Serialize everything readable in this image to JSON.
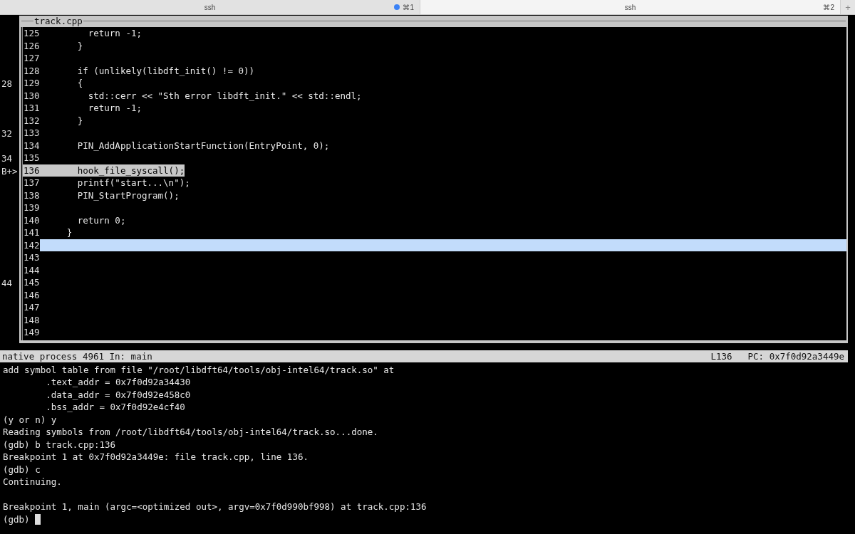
{
  "tabs": [
    {
      "label": "ssh",
      "shortcut": "⌘1",
      "activity": true,
      "selected": false
    },
    {
      "label": "ssh",
      "shortcut": "⌘2",
      "activity": false,
      "selected": true
    }
  ],
  "new_tab": "+",
  "source": {
    "title": "track.cpp",
    "lines": [
      {
        "number": "125",
        "code": "         return -1;",
        "highlighted": false,
        "selected": false
      },
      {
        "number": "126",
        "code": "       }",
        "highlighted": false,
        "selected": false
      },
      {
        "number": "127",
        "highlighted": false,
        "selected": false
      },
      {
        "number": "128",
        "code": "       if (unlikely(libdft_init() != 0))",
        "highlighted": false,
        "selected": false
      },
      {
        "number": "129",
        "gutter": "28",
        "code": "       {",
        "highlighted": false,
        "selected": false
      },
      {
        "number": "130",
        "code": "         std::cerr << \"Sth error libdft_init.\" << std::endl;",
        "highlighted": false,
        "selected": false
      },
      {
        "number": "131",
        "code": "         return -1;",
        "highlighted": false,
        "selected": false
      },
      {
        "number": "132",
        "code": "       }",
        "highlighted": false,
        "selected": false
      },
      {
        "number": "133",
        "gutter": "32",
        "highlighted": false,
        "selected": false
      },
      {
        "number": "134",
        "code": "       PIN_AddApplicationStartFunction(EntryPoint, 0);",
        "highlighted": false,
        "selected": false
      },
      {
        "number": "135",
        "gutter": "34",
        "highlighted": false,
        "selected": false
      },
      {
        "number": "136",
        "gutter": "B+>",
        "code": "       hook_file_syscall();",
        "highlighted": true,
        "selected": false
      },
      {
        "number": "137",
        "code": "       printf(\"start...\\n\");",
        "highlighted": false,
        "selected": false
      },
      {
        "number": "138",
        "code": "       PIN_StartProgram();",
        "highlighted": false,
        "selected": false
      },
      {
        "number": "139",
        "highlighted": false,
        "selected": false
      },
      {
        "number": "140",
        "code": "       return 0;",
        "highlighted": false,
        "selected": false
      },
      {
        "number": "141",
        "code": "     }",
        "highlighted": false,
        "selected": false
      },
      {
        "number": "142",
        "highlighted": false,
        "selected": true
      },
      {
        "number": "143",
        "highlighted": false,
        "selected": false
      },
      {
        "number": "144",
        "highlighted": false,
        "selected": false
      },
      {
        "number": "145",
        "gutter": "44",
        "highlighted": false,
        "selected": false
      },
      {
        "number": "146",
        "highlighted": false,
        "selected": false
      },
      {
        "number": "147",
        "highlighted": false,
        "selected": false
      },
      {
        "number": "148",
        "highlighted": false,
        "selected": false
      },
      {
        "number": "149",
        "highlighted": false,
        "selected": false
      }
    ]
  },
  "status_bar": {
    "process": "native process 4961 In: main",
    "line": "L136",
    "pc": "PC: 0x7f0d92a3449e"
  },
  "console": [
    {
      "kind": "text",
      "text": "add symbol table from file \"/root/libdft64/tools/obj-intel64/track.so\" at"
    },
    {
      "kind": "text",
      "text": "        .text_addr = 0x7f0d92a34430"
    },
    {
      "kind": "text",
      "text": "        .data_addr = 0x7f0d92e458c0"
    },
    {
      "kind": "text",
      "text": "        .bss_addr = 0x7f0d92e4cf40"
    },
    {
      "kind": "text",
      "text": "(y or n) y"
    },
    {
      "kind": "text",
      "text": "Reading symbols from /root/libdft64/tools/obj-intel64/track.so...done."
    },
    {
      "kind": "text",
      "text": "(gdb) b track.cpp:136"
    },
    {
      "kind": "text",
      "text": "Breakpoint 1 at 0x7f0d92a3449e: file track.cpp, line 136."
    },
    {
      "kind": "text",
      "text": "(gdb) c"
    },
    {
      "kind": "text",
      "text": "Continuing."
    },
    {
      "kind": "blank"
    },
    {
      "kind": "text",
      "text": "Breakpoint 1, main (argc=<optimized out>, argv=0x7f0d990bf998) at track.cpp:136"
    },
    {
      "kind": "prompt",
      "text": "(gdb)"
    }
  ]
}
